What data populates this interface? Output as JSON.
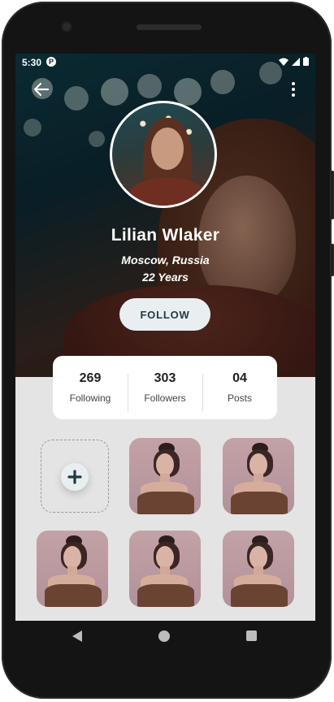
{
  "status_bar": {
    "time": "5:30",
    "app_icon": "P",
    "icons": [
      "wifi-icon",
      "signal-icon",
      "battery-icon"
    ]
  },
  "header": {
    "back_icon": "arrow-left-icon",
    "menu_icon": "more-vertical-icon"
  },
  "profile": {
    "name": "Lilian Wlaker",
    "location": "Moscow, Russia",
    "age": "22 Years",
    "follow_label": "FOLLOW"
  },
  "stats": [
    {
      "value": "269",
      "label": "Following"
    },
    {
      "value": "303",
      "label": "Followers"
    },
    {
      "value": "04",
      "label": "Posts"
    }
  ],
  "gallery": {
    "add_icon": "plus-icon",
    "photo_count": 5
  },
  "nav_bar": {
    "icons": [
      "back-triangle-icon",
      "home-circle-icon",
      "recent-square-icon"
    ]
  },
  "colors": {
    "follow_button_bg": "#e9eef1",
    "follow_button_text": "#1e3a44",
    "screen_bg": "#e4e4e4",
    "card_bg": "#ffffff"
  }
}
